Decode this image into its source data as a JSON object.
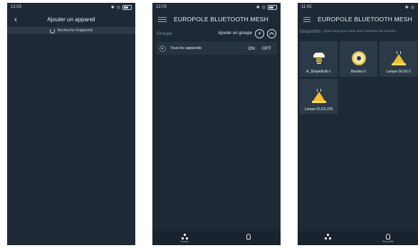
{
  "phone1": {
    "status": {
      "time": "12:03"
    },
    "header": {
      "title": "Ajouter un appareil"
    },
    "scan": {
      "text": "Recherche d'appareils"
    }
  },
  "phone2": {
    "status": {
      "time": "12:03"
    },
    "header": {
      "title": "EUROPOLE BLUETOOTH MESH"
    },
    "group_bar": {
      "label": "Groupe",
      "add_label": "Ajouter un groupe"
    },
    "group_row": {
      "label": "Tous les appareils",
      "on_label": "ON",
      "off_label": "OFF"
    },
    "nav": {
      "groups_label": "Groupe"
    }
  },
  "phone3": {
    "status": {
      "time": "11:42"
    },
    "header": {
      "title": "EUROPOLE BLUETOOTH MESH"
    },
    "devices_bar": {
      "label": "Dispositifs",
      "hint": "(Appui long pour entrer dans l'interface de contrôle)"
    },
    "devices": [
      {
        "name": "A_ShapeBulb-1",
        "icon": "bulb-icon"
      },
      {
        "name": "Bandes-2",
        "icon": "led-strip-icon"
      },
      {
        "name": "Lampe GU10-3",
        "icon": "spotlight-icon"
      },
      {
        "name": "Lampe GU10-206",
        "icon": "spotlight-icon"
      }
    ],
    "nav": {
      "devices_label": "Dispositifs"
    }
  },
  "colors": {
    "background": "#1d2a36",
    "accent_bulb": "#f0c02a"
  }
}
